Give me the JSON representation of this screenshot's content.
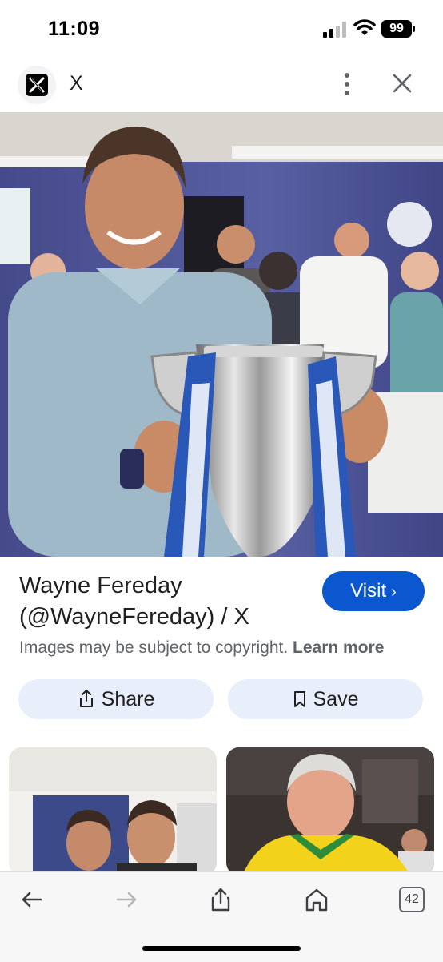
{
  "status_bar": {
    "time": "11:09",
    "battery": "99"
  },
  "header": {
    "site_name": "X"
  },
  "result": {
    "title_line1": "Wayne Fereday",
    "title_line2": "(@WayneFereday) / X",
    "visit_label": "Visit",
    "copyright_text": "Images may be subject to copyright.",
    "learn_more": "Learn more",
    "share_label": "Share",
    "save_label": "Save"
  },
  "toolbar": {
    "tabs_count": "42"
  },
  "icons": [
    "x-logo-icon",
    "more-vert-icon",
    "close-icon",
    "share-icon",
    "bookmark-icon",
    "back-icon",
    "forward-icon",
    "share-tb-icon",
    "home-icon"
  ],
  "colors": {
    "accent": "#0b57d0",
    "chip_bg": "#e8effb",
    "text": "#1f1f1f",
    "muted": "#5f6368"
  }
}
